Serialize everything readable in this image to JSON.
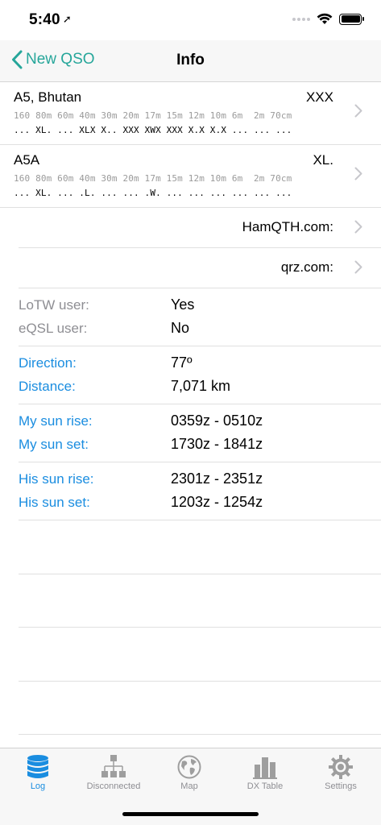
{
  "status_bar": {
    "time": "5:40",
    "location_arrow": "➚"
  },
  "nav": {
    "back_label": "New QSO",
    "title": "Info"
  },
  "band_rows": [
    {
      "name": "A5, Bhutan",
      "status": "XXX",
      "bands": "160 80m 60m 40m 30m 20m 17m 15m 12m 10m 6m  2m 70cm",
      "values": "... XL. ... XLX X.. XXX XWX XXX X.X X.X ... ... ..."
    },
    {
      "name": "A5A",
      "status": "XL.",
      "bands": "160 80m 60m 40m 30m 20m 17m 15m 12m 10m 6m  2m 70cm",
      "values": "... XL. ... .L. ... ... .W. ... ... ... ... ... ..."
    }
  ],
  "links": {
    "hamqth": "HamQTH.com:",
    "qrz": "qrz.com:"
  },
  "user_info": {
    "lotw_label": "LoTW user:",
    "lotw_value": "Yes",
    "eqsl_label": "eQSL user:",
    "eqsl_value": "No"
  },
  "geo": {
    "direction_label": "Direction:",
    "direction_value": "77º",
    "distance_label": "Distance:",
    "distance_value": "7,071 km"
  },
  "my_sun": {
    "rise_label": "My sun rise:",
    "rise_value": "0359z - 0510z",
    "set_label": "My sun set:",
    "set_value": "1730z - 1841z"
  },
  "his_sun": {
    "rise_label": "His sun rise:",
    "rise_value": "2301z - 2351z",
    "set_label": "His sun set:",
    "set_value": "1203z - 1254z"
  },
  "tabs": [
    {
      "label": "Log",
      "icon": "database-icon",
      "active": true
    },
    {
      "label": "Disconnected",
      "icon": "network-icon",
      "active": false
    },
    {
      "label": "Map",
      "icon": "globe-icon",
      "active": false
    },
    {
      "label": "DX Table",
      "icon": "bar-chart-icon",
      "active": false
    },
    {
      "label": "Settings",
      "icon": "gear-icon",
      "active": false
    }
  ],
  "colors": {
    "accent_teal": "#26a69a",
    "link_blue": "#1a8de0",
    "inactive_gray": "#8e8e93"
  }
}
